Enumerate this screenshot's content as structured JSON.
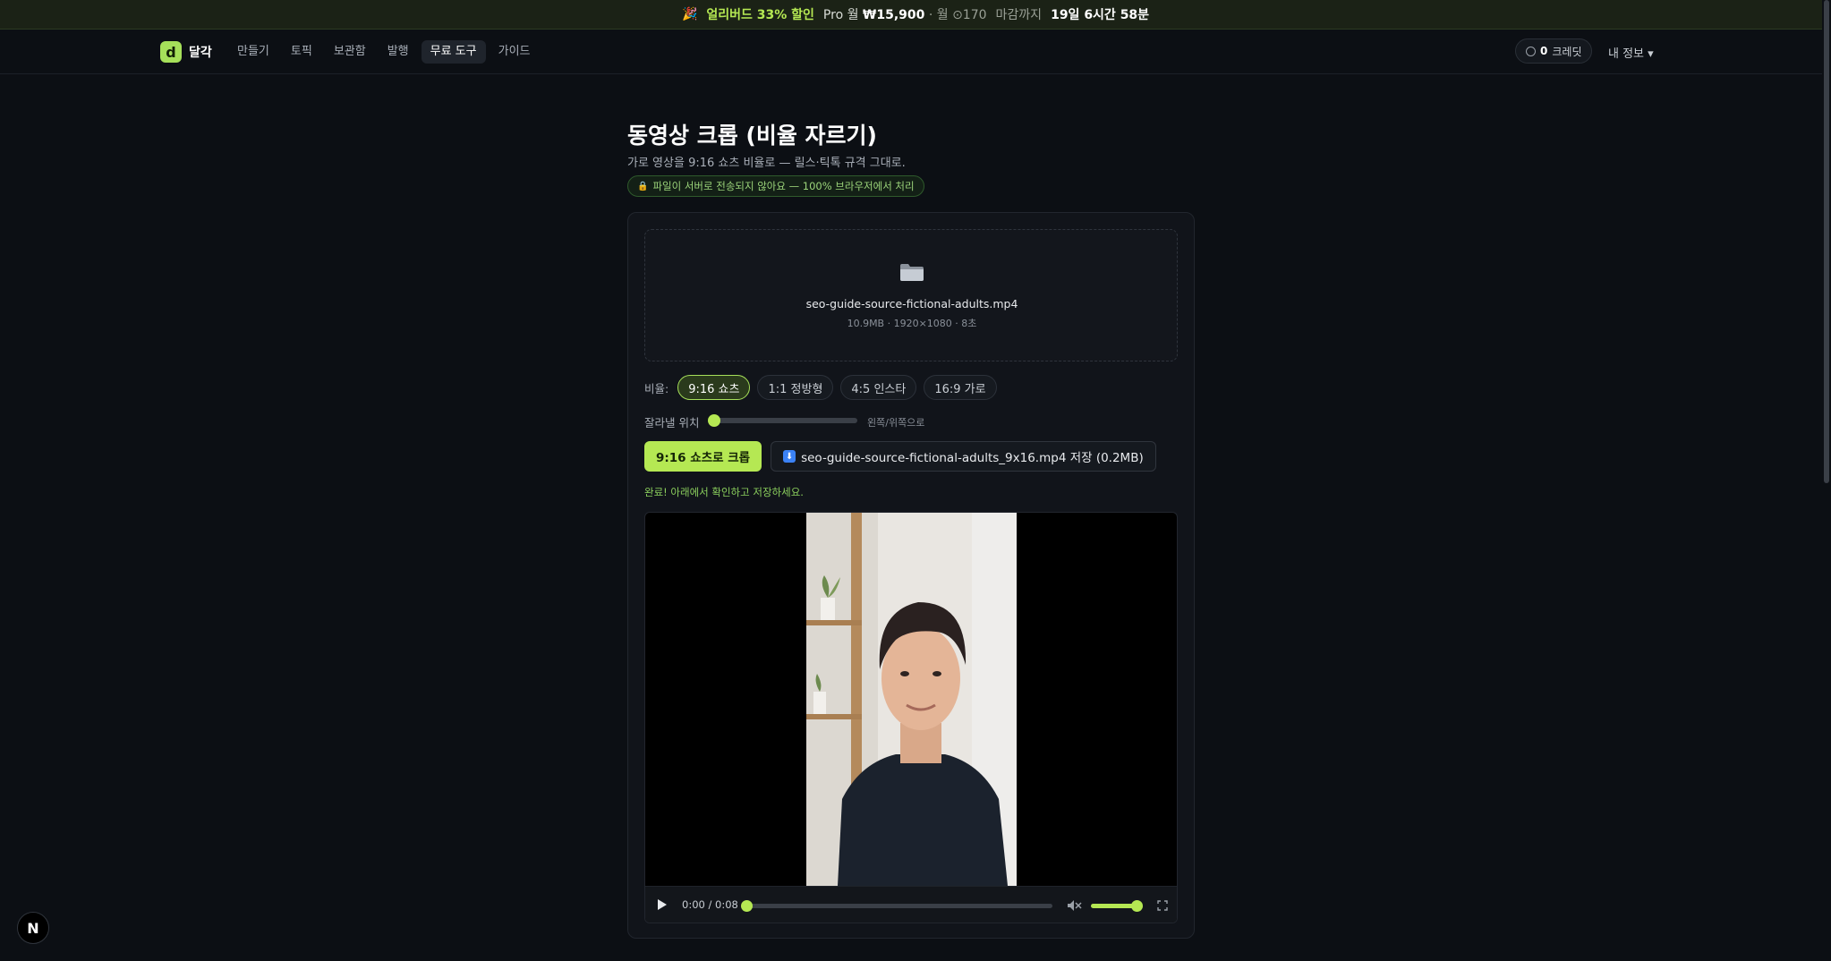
{
  "promo": {
    "emoji": "🎉",
    "discount": "얼리버드 33% 할인",
    "plan_prefix": "Pro 월",
    "price": "₩15,900",
    "separator1": "·",
    "credits_text": "월 ⊙170",
    "deadline_label": "마감까지",
    "deadline_value": "19일 6시간 58분"
  },
  "nav": {
    "logo_mark": "d",
    "logo_text": "달각",
    "links": [
      {
        "label": "만들기",
        "active": false
      },
      {
        "label": "토픽",
        "active": false
      },
      {
        "label": "보관함",
        "active": false
      },
      {
        "label": "발행",
        "active": false
      },
      {
        "label": "무료 도구",
        "active": true
      },
      {
        "label": "가이드",
        "active": false
      }
    ],
    "credits_count": "0",
    "credits_label": "크레딧",
    "profile_label": "내 정보 ▾"
  },
  "header": {
    "title": "동영상 크롭 (비율 자르기)",
    "subtitle": "가로 영상을 9:16 쇼츠 비율로 — 릴스·틱톡 규격 그대로.",
    "privacy_icon": "🔒",
    "privacy": "파일이 서버로 전송되지 않아요 — 100% 브라우저에서 처리"
  },
  "file": {
    "name": "seo-guide-source-fictional-adults.mp4",
    "meta": "10.9MB · 1920×1080 · 8초"
  },
  "ratio": {
    "label": "비율:",
    "options": [
      {
        "label": "9:16 쇼츠",
        "active": true
      },
      {
        "label": "1:1 정방형",
        "active": false
      },
      {
        "label": "4:5 인스타",
        "active": false
      },
      {
        "label": "16:9 가로",
        "active": false
      }
    ]
  },
  "position": {
    "label": "잘라낼 위치",
    "value": 0,
    "hint": "왼쪽/위쪽으로"
  },
  "actions": {
    "crop_label": "9:16 쇼츠로 크롭",
    "download_label": "seo-guide-source-fictional-adults_9x16.mp4 저장 (0.2MB)"
  },
  "status": {
    "done": "완료! 아래에서 확인하고 저장하세요."
  },
  "player": {
    "time": "0:00 / 0:08",
    "progress": 0,
    "volume": 1
  },
  "icons": {
    "folder": "folder-icon",
    "download": "download-icon",
    "play": "play-icon",
    "volume": "volume-muted-icon",
    "fullscreen": "fullscreen-icon",
    "badge": "N"
  },
  "colors": {
    "accent": "#b5e853",
    "background": "#0c0f14",
    "card": "#11141a"
  }
}
